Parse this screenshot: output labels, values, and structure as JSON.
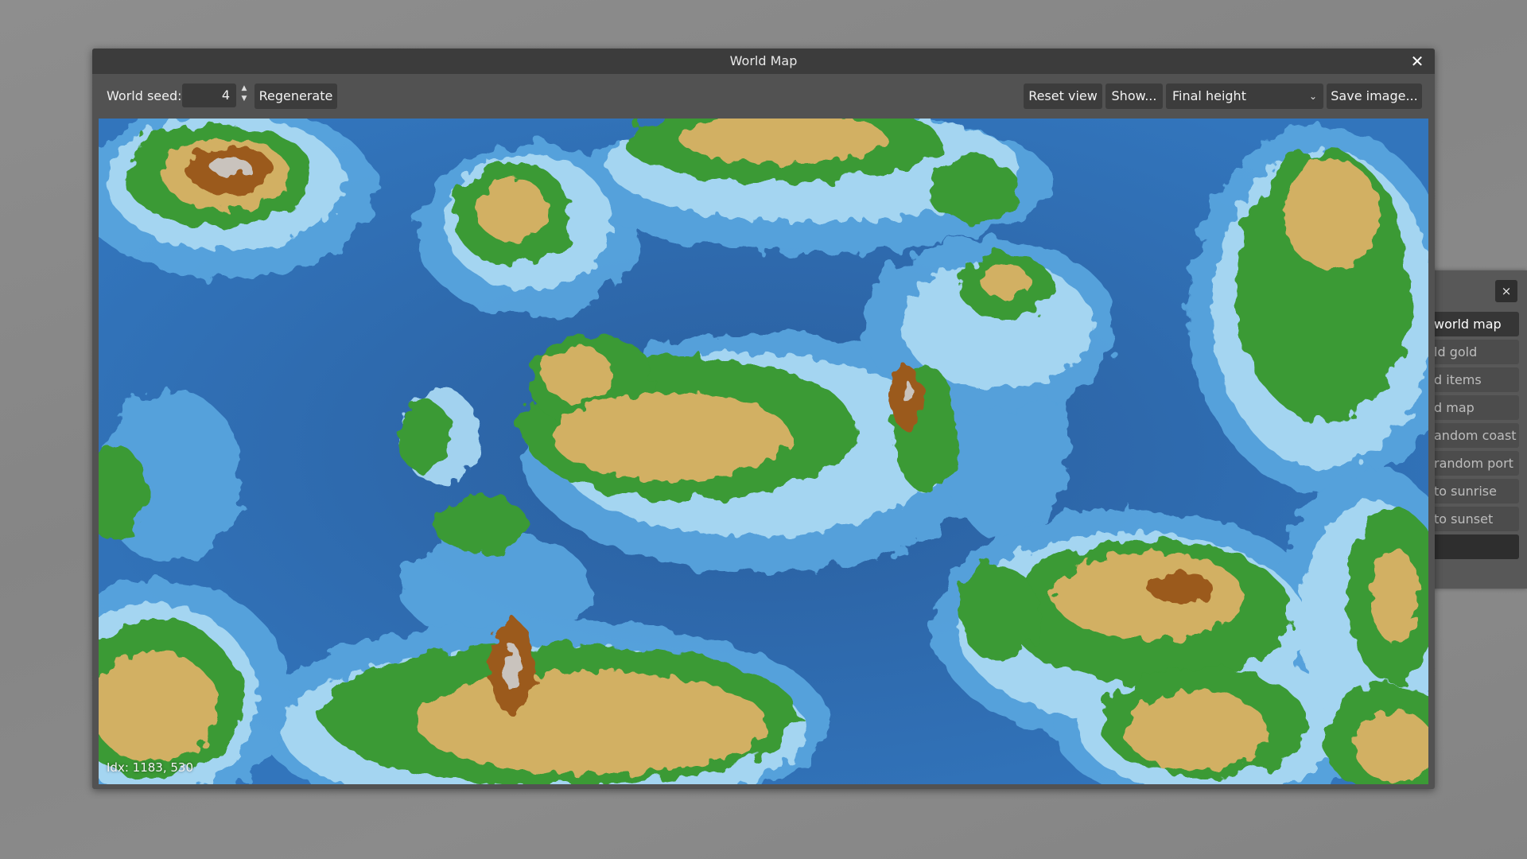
{
  "window": {
    "title": "World Map",
    "close_glyph": "✕"
  },
  "toolbar": {
    "seed_label": "World seed:",
    "seed_value": "4",
    "spinner_up": "▲",
    "spinner_down": "▼",
    "regenerate_label": "Regenerate",
    "reset_view_label": "Reset view",
    "show_label": "Show...",
    "map_mode_selected": "Final height",
    "select_arrow": "⌄",
    "save_image_label": "Save image..."
  },
  "map": {
    "coords_text": "Idx: 1183, 530"
  },
  "side_panel": {
    "close_glyph": "×",
    "items": [
      {
        "label": "world map"
      },
      {
        "label": "ld gold"
      },
      {
        "label": "d items"
      },
      {
        "label": "d map"
      },
      {
        "label": "andom coast"
      },
      {
        "label": "random port"
      },
      {
        "label": "to sunrise"
      },
      {
        "label": " to sunset"
      },
      {
        "label": ""
      }
    ]
  },
  "colors": {
    "deep_water": "#2f6eb2",
    "shallow_water": "#9fd0ef",
    "coast": "#d8eefa",
    "lowland": "#2e8b2e",
    "midland": "#d4b060",
    "highland": "#9a5a1e",
    "peak": "#d9d9d9"
  }
}
